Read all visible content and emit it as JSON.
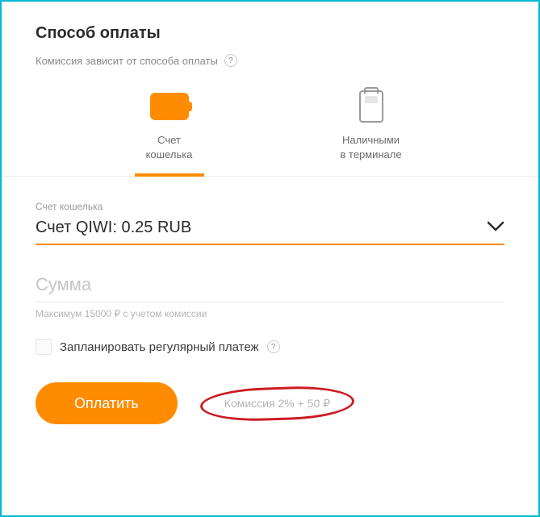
{
  "header": {
    "title": "Способ оплаты",
    "subtitle": "Комиссия зависит от способа оплаты",
    "help": "?"
  },
  "methods": {
    "wallet": "Счет\nкошелька",
    "terminal": "Наличными\nв терминале"
  },
  "walletSelect": {
    "label": "Счет кошелька",
    "value": "Счет QIWI: 0.25 RUB"
  },
  "amount": {
    "placeholder": "Сумма",
    "hint": "Максимум 15000 ₽ с учетом комиссии"
  },
  "schedule": {
    "label": "Запланировать регулярный платеж",
    "help": "?"
  },
  "footer": {
    "payLabel": "Оплатить",
    "commission": "Комиссия 2% + 50 ₽"
  }
}
